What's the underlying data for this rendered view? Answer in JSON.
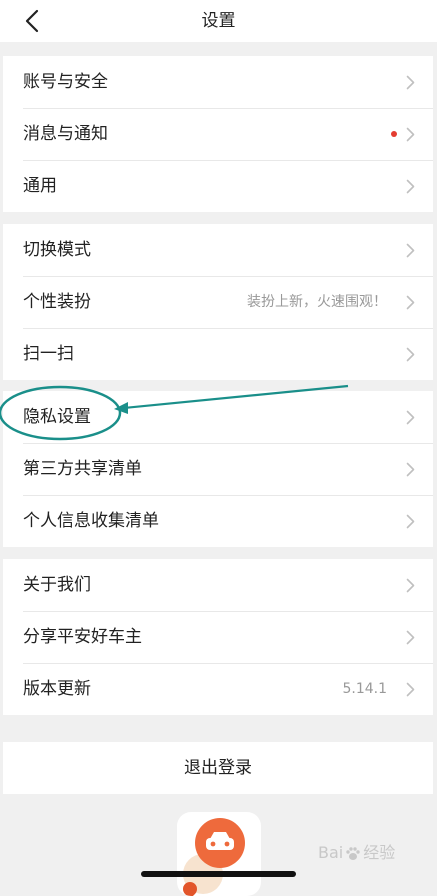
{
  "header": {
    "title": "设置",
    "back_icon": "chevron-left-icon"
  },
  "groups": [
    {
      "items": [
        {
          "label": "账号与安全",
          "icon": "chevron-right-icon"
        },
        {
          "label": "消息与通知",
          "badge": "red-dot",
          "icon": "chevron-right-icon"
        },
        {
          "label": "通用",
          "icon": "chevron-right-icon"
        }
      ]
    },
    {
      "items": [
        {
          "label": "切换模式",
          "icon": "chevron-right-icon"
        },
        {
          "label": "个性装扮",
          "value": "装扮上新，火速围观！",
          "icon": "chevron-right-icon"
        },
        {
          "label": "扫一扫",
          "icon": "chevron-right-icon"
        }
      ]
    },
    {
      "items": [
        {
          "label": "隐私设置",
          "icon": "chevron-right-icon"
        },
        {
          "label": "第三方共享清单",
          "icon": "chevron-right-icon"
        },
        {
          "label": "个人信息收集清单",
          "icon": "chevron-right-icon"
        }
      ]
    },
    {
      "items": [
        {
          "label": "关于我们",
          "icon": "chevron-right-icon"
        },
        {
          "label": "分享平安好车主",
          "icon": "chevron-right-icon"
        },
        {
          "label": "版本更新",
          "value": "5.14.1",
          "icon": "chevron-right-icon"
        }
      ]
    }
  ],
  "logout": {
    "label": "退出登录"
  },
  "watermark": {
    "text_left": "Bai",
    "text_right": "经验",
    "icon": "paw-icon"
  },
  "colors": {
    "background": "#f0f0f0",
    "annotation": "#1a8f8a",
    "badge": "#e43c30",
    "app_logo": "#ee6a3c"
  }
}
